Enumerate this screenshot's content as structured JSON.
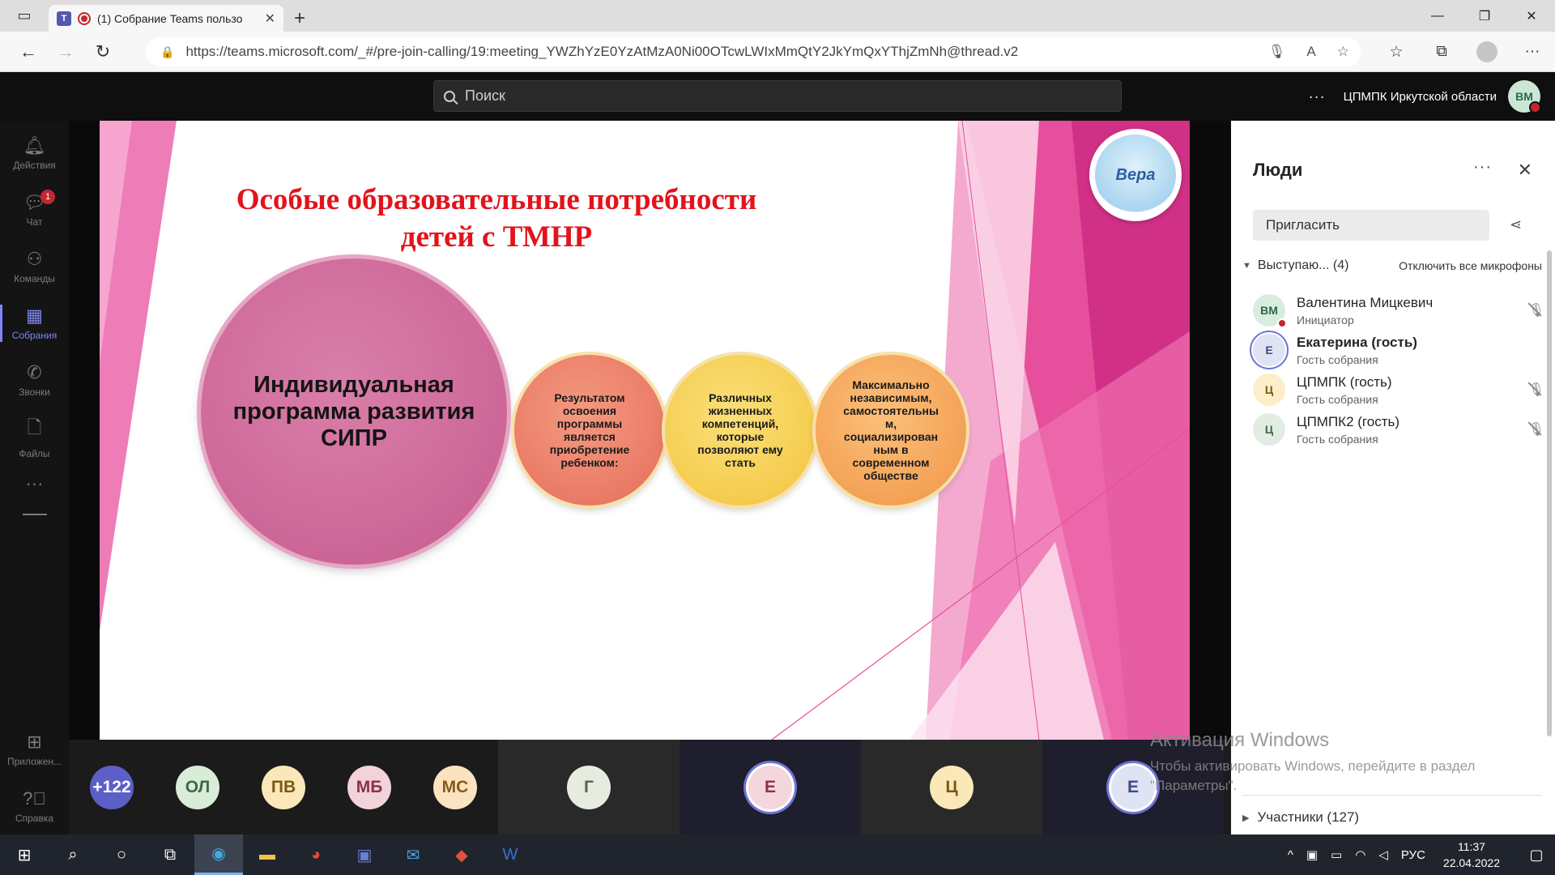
{
  "browser": {
    "tab_title": "(1) Собрание Teams пользо",
    "url": "https://teams.microsoft.com/_#/pre-join-calling/19:meeting_YWZhYzE0YzAtMzA0Ni00OTcwLWIxMmQtY2JkYmQxYThjZmNh@thread.v2"
  },
  "teams": {
    "search_placeholder": "Поиск",
    "org_name": "ЦПМПК Иркутской области",
    "user_initials": "ВМ"
  },
  "rail": {
    "items": [
      {
        "label": "Действия",
        "icon": "bell-icon"
      },
      {
        "label": "Чат",
        "icon": "chat-icon",
        "badge": "1"
      },
      {
        "label": "Команды",
        "icon": "teams-icon"
      },
      {
        "label": "Собрания",
        "icon": "calendar-icon"
      },
      {
        "label": "Звонки",
        "icon": "phone-icon"
      },
      {
        "label": "Файлы",
        "icon": "file-icon"
      }
    ],
    "more": "···",
    "apps": "Приложен...",
    "help": "Справка"
  },
  "slide": {
    "title": "Особые образовательные потребности детей с ТМНР",
    "big_circle": "Индивидуальная программа развития СИПР",
    "circle1": "Результатом освоения программы является приобретение ребенком:",
    "circle2": "Различных жизненных компетенций, которые позволяют ему стать",
    "circle3": "Максимально независимым, самостоятельны м, социализирован ным в современном обществе",
    "logo_text": "Вера"
  },
  "strip": [
    {
      "initials": "+122",
      "bg": "#5b5fc7",
      "fg": "#ffffff"
    },
    {
      "initials": "ОЛ",
      "bg": "#d8ecd8",
      "fg": "#3d6a48"
    },
    {
      "initials": "ПВ",
      "bg": "#fbe8b8",
      "fg": "#7a5a12"
    },
    {
      "initials": "МБ",
      "bg": "#f1d3d9",
      "fg": "#8a3346"
    },
    {
      "initials": "МС",
      "bg": "#fbe3c0",
      "fg": "#8a5a18"
    },
    {
      "initials": "Г",
      "bg": "#e6ede0",
      "fg": "#506a40"
    },
    {
      "initials": "Е",
      "bg": "#f3d7dd",
      "fg": "#8a3346"
    },
    {
      "initials": "Ц",
      "bg": "#fbe8b8",
      "fg": "#7a5a12"
    },
    {
      "initials": "Е",
      "bg": "#dfe3f3",
      "fg": "#3d4a8a"
    }
  ],
  "people": {
    "title": "Люди",
    "invite": "Пригласить",
    "presenters_label": "Выступаю... (4)",
    "mute_all": "Отключить все микрофоны",
    "list": [
      {
        "initials": "ВМ",
        "name": "Валентина Мицкевич",
        "role": "Инициатор",
        "bg": "#d8ecdf",
        "fg": "#2a6a45"
      },
      {
        "initials": "Е",
        "name": "Екатерина (гость)",
        "role": "Гость собрания",
        "bg": "#dfe3f3",
        "fg": "#3d4a8a"
      },
      {
        "initials": "Ц",
        "name": "ЦПМПК (гость)",
        "role": "Гость собрания",
        "bg": "#fbeec8",
        "fg": "#7a5a12"
      },
      {
        "initials": "Ц",
        "name": "ЦПМПК2 (гость)",
        "role": "Гость собрания",
        "bg": "#e2ece2",
        "fg": "#3d6a48"
      }
    ],
    "participants": "Участники (127)"
  },
  "watermark": {
    "title": "Активация Windows",
    "text": "Чтобы активировать Windows, перейдите в раздел \"Параметры\"."
  },
  "taskbar": {
    "lang": "РУС",
    "time": "11:37",
    "date": "22.04.2022"
  }
}
